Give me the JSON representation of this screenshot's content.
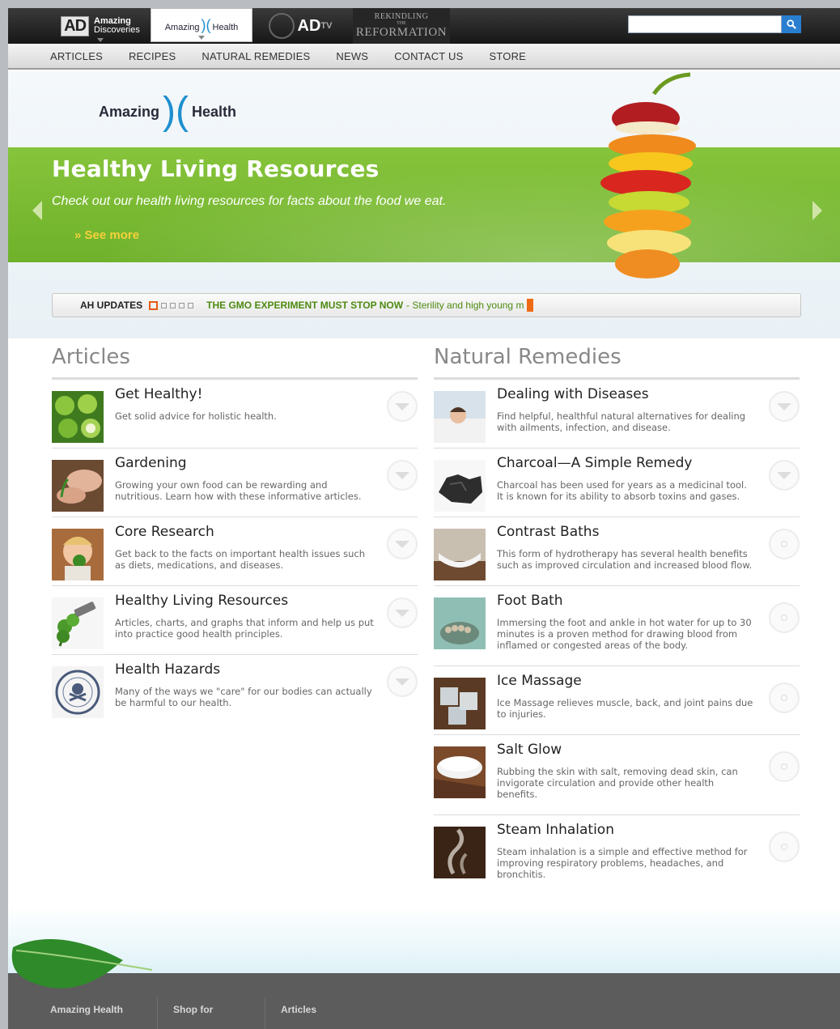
{
  "topbar": {
    "ad_box": "AD",
    "ad_line1": "Amazing",
    "ad_line2": "Discoveries",
    "ah_left": "Amazing",
    "ah_right": "Health",
    "adtv_main": "AD",
    "adtv_sub": "TV",
    "rr_line1": "REKINDLING",
    "rr_line2": "THE",
    "rr_line3": "REFORMATION",
    "search_placeholder": ""
  },
  "nav": [
    "ARTICLES",
    "RECIPES",
    "NATURAL REMEDIES",
    "NEWS",
    "CONTACT US",
    "STORE"
  ],
  "hero": {
    "logo_left": "Amazing",
    "logo_right": "Health",
    "title": "Healthy Living Resources",
    "subtitle": "Check out our health living resources for facts about the food we eat.",
    "more": "» See more"
  },
  "ticker": {
    "label": "AH UPDATES",
    "headline": "THE GMO EXPERIMENT MUST STOP NOW",
    "rest": "- Sterility and high young m"
  },
  "articles": {
    "title": "Articles",
    "items": [
      {
        "title": "Get Healthy!",
        "desc": "Get solid advice for holistic health."
      },
      {
        "title": "Gardening",
        "desc": "Growing your own food can be rewarding and nutritious. Learn how with these informative articles."
      },
      {
        "title": "Core Research",
        "desc": "Get back to the facts on important health issues such as diets, medications, and diseases."
      },
      {
        "title": "Healthy Living Resources",
        "desc": "Articles, charts, and graphs that inform and help us put into practice good health principles."
      },
      {
        "title": "Health Hazards",
        "desc": "Many of the ways we \"care\" for our bodies can actually be harmful to our health."
      }
    ]
  },
  "remedies": {
    "title": "Natural Remedies",
    "items": [
      {
        "title": "Dealing with Diseases",
        "desc": "Find helpful, healthful natural alternatives for dealing with ailments, infection, and disease."
      },
      {
        "title": "Charcoal—A Simple Remedy",
        "desc": "Charcoal has been used for years as a medicinal tool. It is known for its ability to absorb toxins and gases."
      },
      {
        "title": "Contrast Baths",
        "desc": "This form of hydrotherapy has several health benefits such as improved circulation and increased blood flow."
      },
      {
        "title": "Foot Bath",
        "desc": "Immersing the foot and ankle in hot water for up to 30 minutes is a proven method for drawing blood from inflamed or congested areas of the body."
      },
      {
        "title": "Ice Massage",
        "desc": "Ice Massage relieves muscle, back, and joint pains due to injuries."
      },
      {
        "title": "Salt Glow",
        "desc": "Rubbing the skin with salt, removing dead skin, can invigorate circulation and provide other health benefits."
      },
      {
        "title": "Steam Inhalation",
        "desc": "Steam inhalation is a simple and effective method for improving respiratory problems, headaches, and bronchitis."
      }
    ]
  },
  "footer": [
    "Amazing Health",
    "Shop for",
    "Articles"
  ],
  "colors": {
    "green": "#7dbd33",
    "accent": "#e65b13",
    "footer": "#5c5c5c",
    "search_button": "#2a7ed0"
  }
}
